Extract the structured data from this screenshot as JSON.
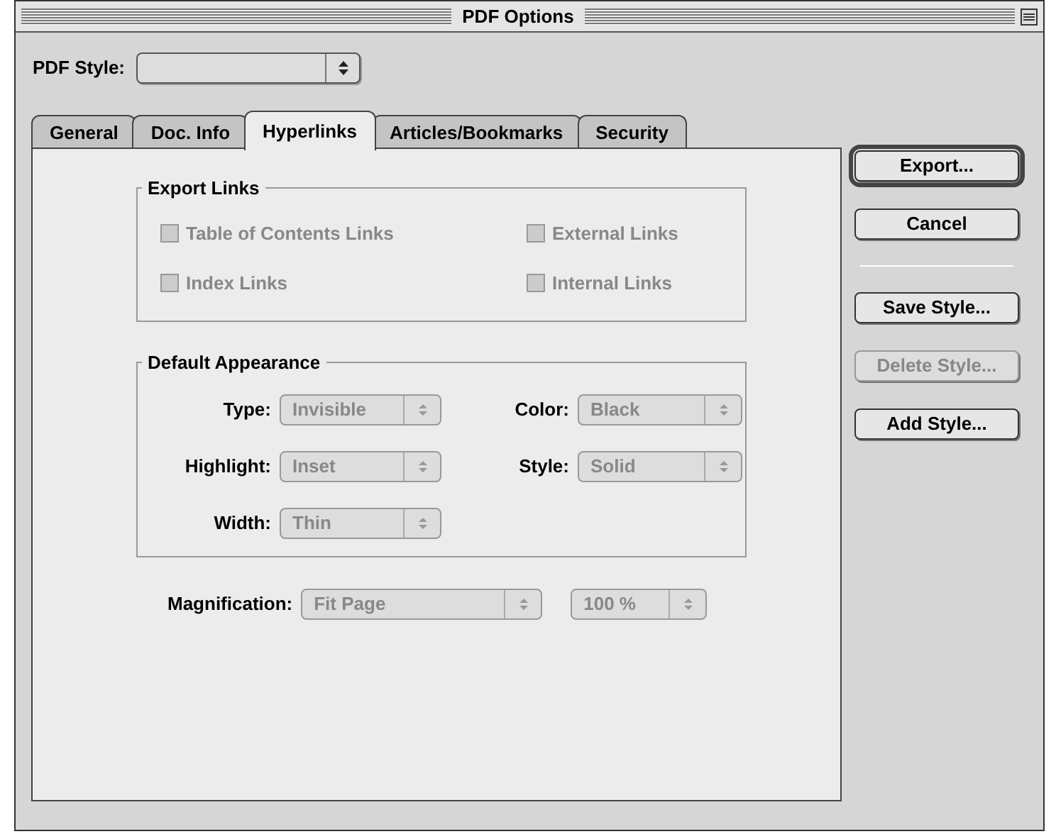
{
  "window": {
    "title": "PDF Options"
  },
  "pdf_style": {
    "label": "PDF Style:"
  },
  "tabs": [
    {
      "label": "General",
      "selected": false
    },
    {
      "label": "Doc. Info",
      "selected": false
    },
    {
      "label": "Hyperlinks",
      "selected": true
    },
    {
      "label": "Articles/Bookmarks",
      "selected": false
    },
    {
      "label": "Security",
      "selected": false
    }
  ],
  "export_links": {
    "title": "Export Links",
    "checkboxes": [
      {
        "label": "Table of Contents Links",
        "checked": false,
        "disabled": true
      },
      {
        "label": "External Links",
        "checked": false,
        "disabled": true
      },
      {
        "label": "Index Links",
        "checked": false,
        "disabled": true
      },
      {
        "label": "Internal Links",
        "checked": false,
        "disabled": true
      }
    ]
  },
  "default_appearance": {
    "title": "Default Appearance",
    "fields": [
      {
        "label": "Type:",
        "value": "Invisible",
        "disabled": true
      },
      {
        "label": "Color:",
        "value": "Black",
        "disabled": true
      },
      {
        "label": "Highlight:",
        "value": "Inset",
        "disabled": true
      },
      {
        "label": "Style:",
        "value": "Solid",
        "disabled": true
      },
      {
        "label": "Width:",
        "value": "Thin",
        "disabled": true
      }
    ]
  },
  "magnification": {
    "label": "Magnification:",
    "value": "Fit Page",
    "zoom": "100 %",
    "disabled": true
  },
  "buttons": [
    {
      "kind": "button",
      "label": "Export...",
      "default": true,
      "disabled": false
    },
    {
      "kind": "button",
      "label": "Cancel",
      "default": false,
      "disabled": false
    },
    {
      "kind": "separator"
    },
    {
      "kind": "button",
      "label": "Save Style...",
      "default": false,
      "disabled": false
    },
    {
      "kind": "button",
      "label": "Delete Style...",
      "default": false,
      "disabled": true
    },
    {
      "kind": "button",
      "label": "Add Style...",
      "default": false,
      "disabled": false
    }
  ]
}
